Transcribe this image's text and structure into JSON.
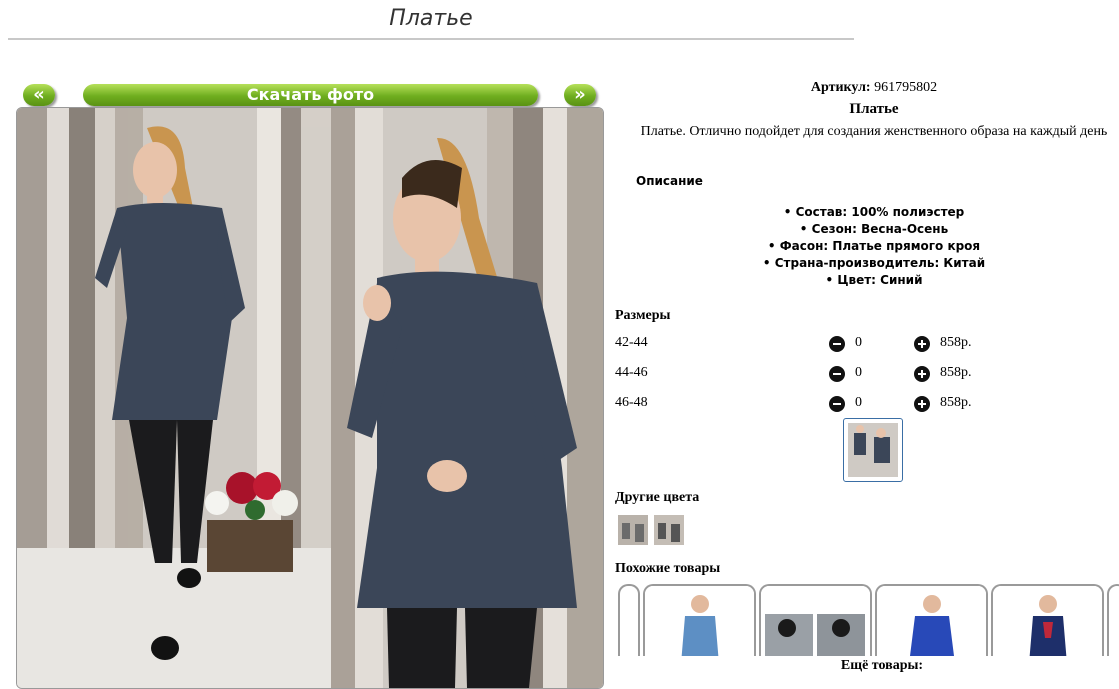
{
  "page": {
    "title": "Платье"
  },
  "gallery": {
    "prev_label": "«",
    "download_label": "Скачать фото",
    "next_label": "»"
  },
  "product": {
    "article_label": "Артикул:",
    "article_value": "961795802",
    "name": "Платье",
    "description": "Платье. Отлично подойдет для создания женственного образа на каждый день"
  },
  "description": {
    "heading": "Описание",
    "items": [
      "• Состав: 100% полиэстер",
      "• Сезон: Весна-Осень",
      "• Фасон: Платье прямого кроя",
      "• Страна-производитель: Китай",
      "• Цвет: Синий"
    ]
  },
  "sizes": {
    "heading": "Размеры",
    "rows": [
      {
        "name": "42-44",
        "qty": "0",
        "price": "858р."
      },
      {
        "name": "44-46",
        "qty": "0",
        "price": "858р."
      },
      {
        "name": "46-48",
        "qty": "0",
        "price": "858р."
      }
    ]
  },
  "other_colors": {
    "heading": "Другие цвета"
  },
  "similar": {
    "heading": "Похожие товары",
    "more_label": "Ещё товары:"
  },
  "colors": {
    "accent_green": "#6fae1f",
    "dress": "#3b4658",
    "hair": "#c9954f"
  }
}
